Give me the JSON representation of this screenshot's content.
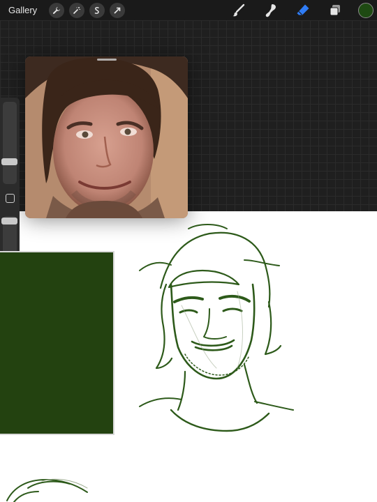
{
  "toolbar": {
    "gallery_label": "Gallery",
    "left_tools": [
      "wrench-icon",
      "magic-wand-icon",
      "selection-icon",
      "transform-arrow-icon"
    ],
    "right_tools": [
      "brush-icon",
      "smudge-icon",
      "eraser-icon",
      "layers-icon"
    ],
    "active_tool": "eraser",
    "current_color": "#1e4a12"
  },
  "sidebar": {
    "brush_size_level": 0.3,
    "opacity_level": 0.95
  },
  "colors": {
    "canvas_background": "#ffffff",
    "grid_background": "#1f1f1f",
    "accent_blue": "#2f7cf6",
    "sketch_green": "#2d5a1a"
  }
}
